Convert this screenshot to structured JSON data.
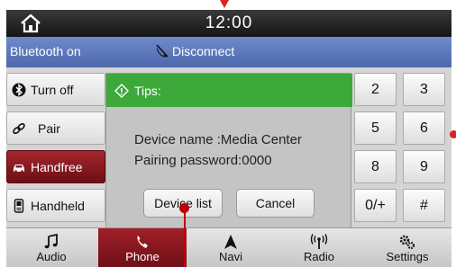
{
  "topbar": {
    "time": "12:00",
    "home_icon": "home-icon"
  },
  "btbar": {
    "status": "Bluetooth on",
    "disconnect_label": "Disconnect",
    "disconnect_icon": "phone-disconnect-icon"
  },
  "side": [
    {
      "label": "Turn off",
      "icon": "bluetooth-icon"
    },
    {
      "label": "Pair",
      "icon": "link-icon"
    },
    {
      "label": "Handfree",
      "icon": "car-icon",
      "active": true
    },
    {
      "label": "Handheld",
      "icon": "handset-icon"
    }
  ],
  "dialog": {
    "title": "Tips:",
    "line1": "Device name :Media Center",
    "line2": "Pairing password:0000",
    "list_button": "Device list",
    "cancel_button": "Cancel"
  },
  "keypad": [
    [
      "2",
      "3"
    ],
    [
      "5",
      "6"
    ],
    [
      "8",
      "9"
    ],
    [
      "0/+",
      "#"
    ]
  ],
  "tabs": [
    {
      "label": "Audio",
      "icon": "music-note-icon"
    },
    {
      "label": "Phone",
      "icon": "phone-icon",
      "active": true
    },
    {
      "label": "Navi",
      "icon": "navigation-arrow-icon"
    },
    {
      "label": "Radio",
      "icon": "radio-antenna-icon"
    },
    {
      "label": "Settings",
      "icon": "gears-icon"
    }
  ],
  "colors": {
    "accent_active": "#8b1a22",
    "dialog_header": "#3ea93b",
    "status_bar": "#5b78bb",
    "annotation_marker": "#e02020"
  }
}
